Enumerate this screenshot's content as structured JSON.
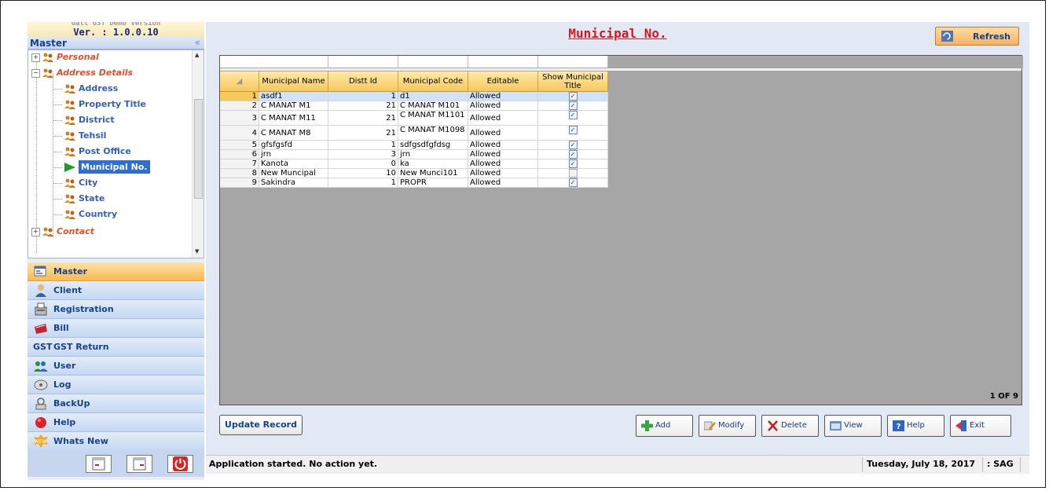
{
  "app": {
    "version": "Ver. : 1.0.0.10",
    "edition_cut": "Gall GST Demo Version"
  },
  "master_header": {
    "title": "Master",
    "collapse_glyph": "«"
  },
  "tree": {
    "personal": "Personal",
    "address_details": "Address Details",
    "leaves": [
      "Address",
      "Property Title",
      "District",
      "Tehsil",
      "Post Office",
      "Municipal No.",
      "City",
      "State",
      "Country"
    ],
    "contact": "Contact"
  },
  "nav": {
    "items": [
      {
        "label": "Master",
        "icon": "master-icon"
      },
      {
        "label": "Client",
        "icon": "client-icon"
      },
      {
        "label": "Registration",
        "icon": "registration-icon"
      },
      {
        "label": "Bill",
        "icon": "bill-icon"
      },
      {
        "label": "GST Return",
        "icon": "gst-icon"
      },
      {
        "label": "User",
        "icon": "user-icon"
      },
      {
        "label": "Log",
        "icon": "log-icon"
      },
      {
        "label": "BackUp",
        "icon": "backup-icon"
      },
      {
        "label": "Help",
        "icon": "help-icon"
      },
      {
        "label": "Whats New",
        "icon": "new-icon"
      }
    ],
    "gst_prefix": "GST",
    "new_badge": "NEW"
  },
  "page": {
    "title": "Municipal No.",
    "refresh": "Refresh"
  },
  "grid": {
    "columns": [
      "Municipal Name",
      "Distt Id",
      "Municipal Code",
      "Editable",
      "Show Municipal Title"
    ],
    "rows": [
      {
        "n": "1",
        "name": "asdf1",
        "distt": "1",
        "code": "d1",
        "editable": "Allowed",
        "show": true
      },
      {
        "n": "2",
        "name": "C MANAT M1",
        "distt": "21",
        "code": "C MANAT M101",
        "editable": "Allowed",
        "show": true
      },
      {
        "n": "3",
        "name": "C MANAT M11",
        "distt": "21",
        "code": "C MANAT M1101",
        "editable": "Allowed",
        "show": true
      },
      {
        "n": "4",
        "name": "C MANAT M8",
        "distt": "21",
        "code": "C MANAT M1098",
        "editable": "Allowed",
        "show": true
      },
      {
        "n": "5",
        "name": "gfsfgsfd",
        "distt": "1",
        "code": "sdfgsdfgfdsg",
        "editable": "Allowed",
        "show": true
      },
      {
        "n": "6",
        "name": "jrn",
        "distt": "3",
        "code": "jrn",
        "editable": "Allowed",
        "show": true
      },
      {
        "n": "7",
        "name": "Kanota",
        "distt": "0",
        "code": "ka",
        "editable": "Allowed",
        "show": true
      },
      {
        "n": "8",
        "name": "New Muncipal",
        "distt": "10",
        "code": "New Munci101",
        "editable": "Allowed",
        "show": false
      },
      {
        "n": "9",
        "name": "Sakindra",
        "distt": "1",
        "code": "PROPR",
        "editable": "Allowed",
        "show": true
      }
    ],
    "pager": "1 OF 9",
    "corner_glyph": "◢",
    "check_glyph": "✓"
  },
  "actions": {
    "update": "Update Record",
    "add": "Add",
    "modify": "Modify",
    "delete": "Delete",
    "view": "View",
    "help": "Help",
    "exit": "Exit"
  },
  "status": {
    "message": "Application started. No action yet.",
    "date": "Tuesday, July 18, 2017",
    "user": ": SAG"
  },
  "colors": {
    "title_red": "#d8141e",
    "nav_text": "#15428b",
    "selected_blue": "#2f6fd1",
    "active_orange": "#f9b952"
  }
}
